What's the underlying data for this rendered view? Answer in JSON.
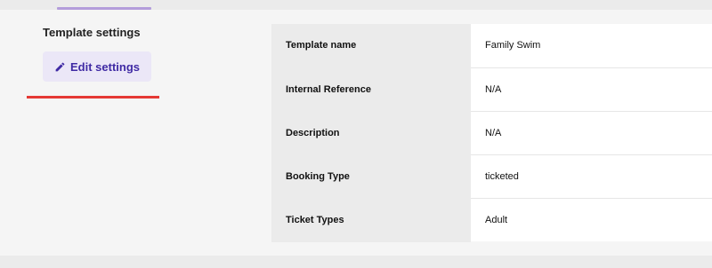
{
  "settings": {
    "title": "Template settings",
    "edit_button_label": "Edit settings",
    "edit_icon": "pencil-icon",
    "accent_color": "#3f2aa4",
    "underline_color": "#e53935"
  },
  "details": {
    "rows": [
      {
        "label": "Template name",
        "value": "Family Swim"
      },
      {
        "label": "Internal Reference",
        "value": "N/A"
      },
      {
        "label": "Description",
        "value": "N/A"
      },
      {
        "label": "Booking Type",
        "value": "ticketed"
      },
      {
        "label": "Ticket Types",
        "value": "Adult"
      }
    ]
  }
}
